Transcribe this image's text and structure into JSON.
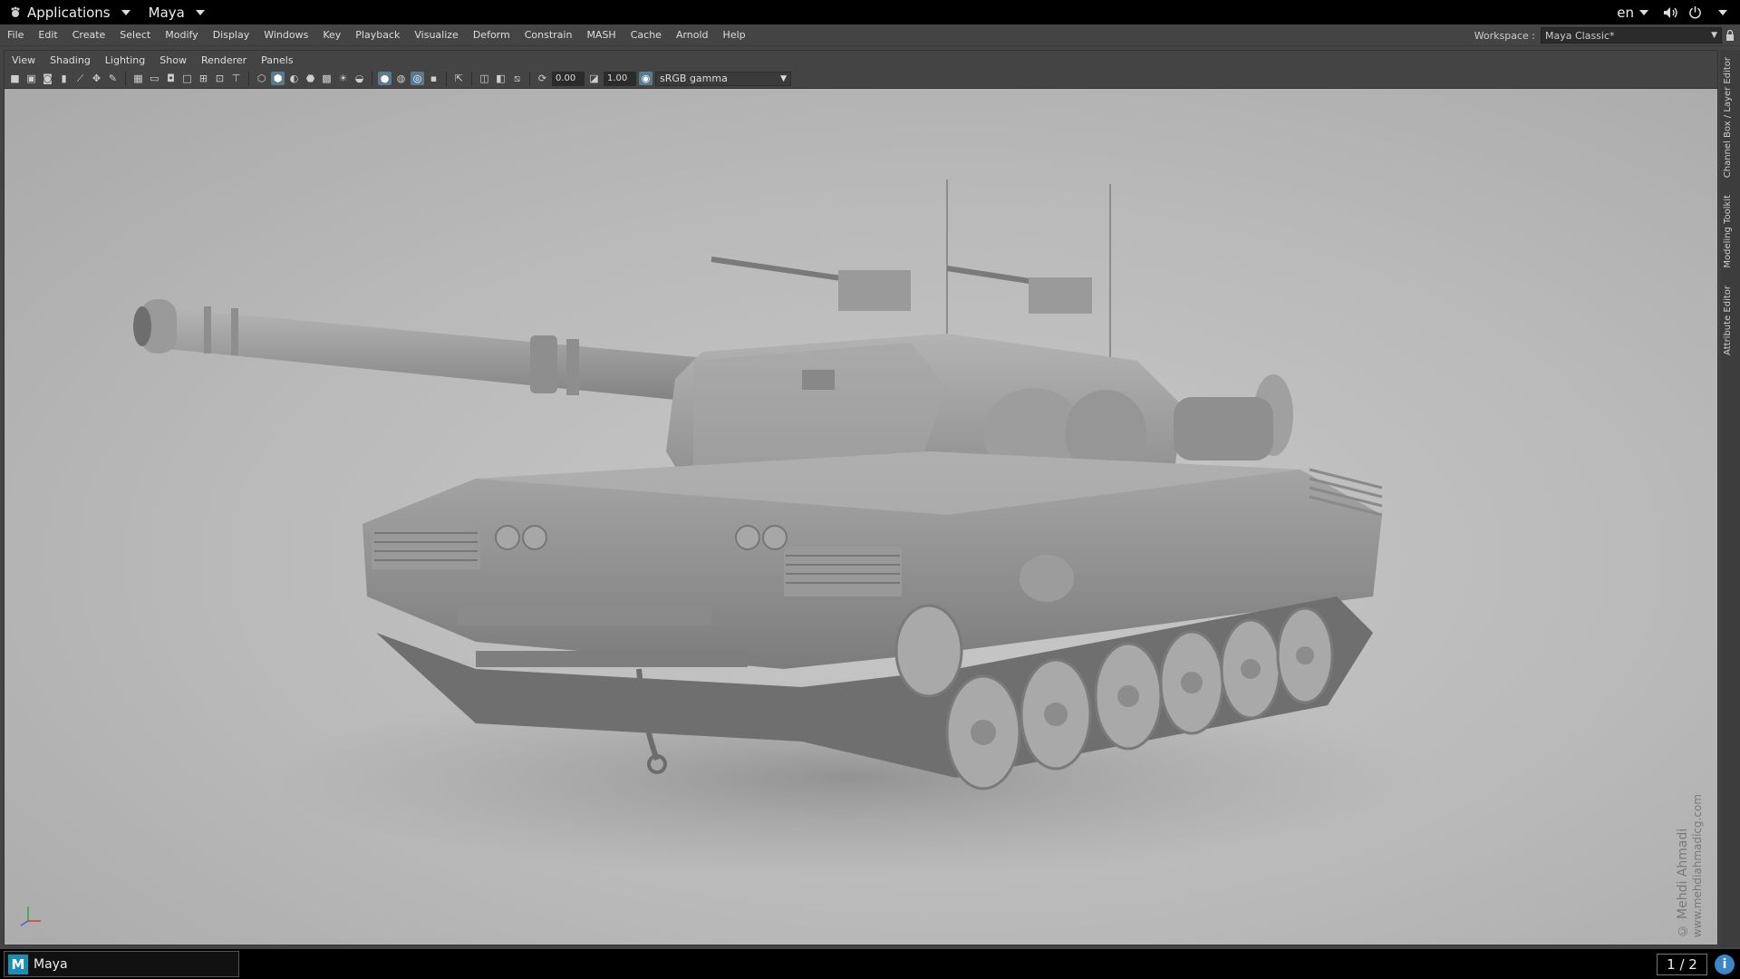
{
  "topbar": {
    "applications_label": "Applications",
    "app_label": "Maya",
    "lang_label": "en",
    "icons": [
      "volume-icon",
      "power-icon"
    ]
  },
  "mainmenu": {
    "items": [
      "File",
      "Edit",
      "Create",
      "Select",
      "Modify",
      "Display",
      "Windows",
      "Key",
      "Playback",
      "Visualize",
      "Deform",
      "Constrain",
      "MASH",
      "Cache",
      "Arnold",
      "Help"
    ],
    "workspace_label": "Workspace :",
    "workspace_value": "Maya Classic*"
  },
  "panel": {
    "menu": [
      "View",
      "Shading",
      "Lighting",
      "Show",
      "Renderer",
      "Panels"
    ],
    "exposure_value": "0.00",
    "gamma_value": "1.00",
    "colorspace_value": "sRGB gamma"
  },
  "viewport": {
    "watermark_name": "© Mehdi Ahmadi",
    "watermark_url": "www.mehdiahmadicg.com"
  },
  "sidetabs": {
    "channel_box": "Channel Box / Layer Editor",
    "modeling_toolkit": "Modeling Toolkit",
    "attribute_editor": "Attribute Editor"
  },
  "taskbar": {
    "maya_label": "Maya",
    "pager": "1 / 2"
  },
  "colors": {
    "accent": "#5a7a8f",
    "maya_logo": "#1a8fb5",
    "info": "#3b86c6"
  }
}
